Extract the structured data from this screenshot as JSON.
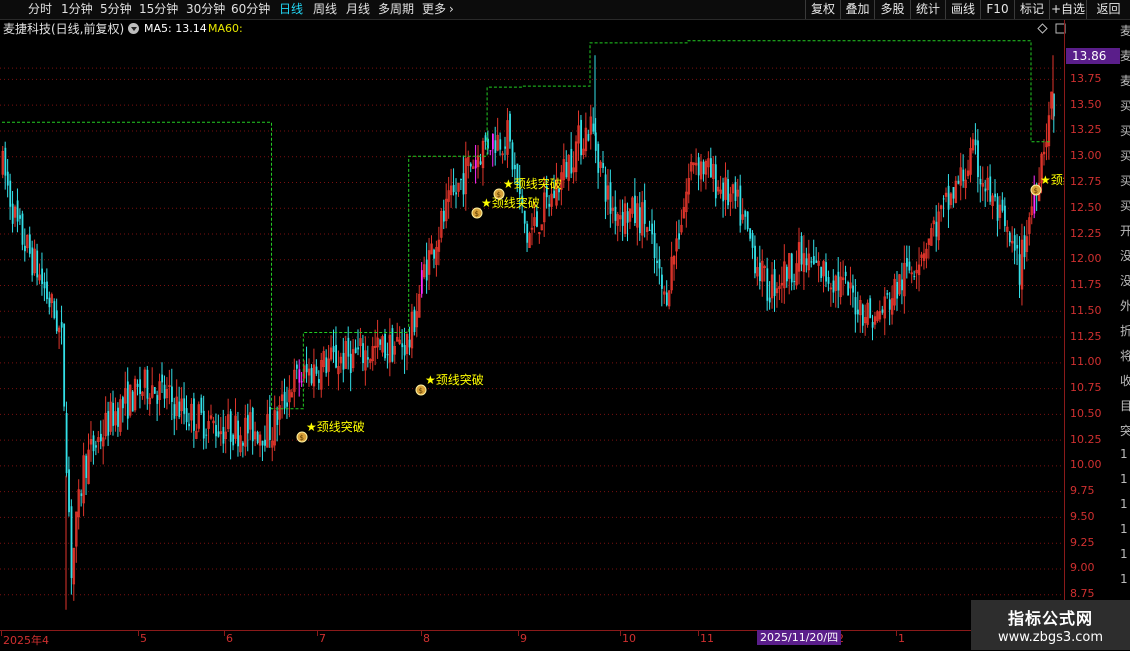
{
  "toolbar": {
    "periods": [
      {
        "label": "分时",
        "active": false
      },
      {
        "label": "1分钟",
        "active": false
      },
      {
        "label": "5分钟",
        "active": false
      },
      {
        "label": "15分钟",
        "active": false
      },
      {
        "label": "30分钟",
        "active": false
      },
      {
        "label": "60分钟",
        "active": false
      },
      {
        "label": "日线",
        "active": true
      },
      {
        "label": "周线",
        "active": false
      },
      {
        "label": "月线",
        "active": false
      },
      {
        "label": "多周期",
        "active": false
      }
    ],
    "more_label": "更多",
    "right_buttons": [
      "复权",
      "叠加",
      "多股",
      "统计",
      "画线",
      "F10",
      "标记",
      "+自选",
      "返回"
    ]
  },
  "info": {
    "title": "麦捷科技(日线,前复权)",
    "ma5": "MA5: 13.14",
    "ma60": "MA60:"
  },
  "colors": {
    "up": "#e0352b",
    "down": "#33e0e8",
    "signal": "#ff2cff",
    "ma60": "#22cc22",
    "annotation": "#ffff00",
    "grid": "#7a1010"
  },
  "price_axis": {
    "labels": [
      "13.75",
      "13.50",
      "13.25",
      "13.00",
      "12.75",
      "12.50",
      "12.25",
      "12.00",
      "11.75",
      "11.50",
      "11.25",
      "11.00",
      "10.75",
      "10.50",
      "10.25",
      "10.00",
      "9.75",
      "9.50",
      "9.25",
      "9.00",
      "8.75"
    ],
    "current": "13.86"
  },
  "time_axis": {
    "labels": [
      "2025年4",
      "5",
      "6",
      "7",
      "8",
      "9",
      "10",
      "11",
      "12",
      "1"
    ],
    "cursor_date": "2025/11/20/四"
  },
  "annotations": [
    "颈线突破",
    "颈线突破",
    "颈线突破",
    "颈线突破",
    "颈线突破",
    "颈线"
  ],
  "side_text": [
    "麦",
    "麦",
    "麦",
    "买",
    "买",
    "买",
    "买",
    "买",
    "开",
    "没",
    "没",
    "外",
    "折",
    "将",
    "收",
    "目",
    "突",
    "1",
    "1",
    "1",
    "1",
    "1",
    "1"
  ],
  "watermark": {
    "line1": "指标公式网",
    "line2": "www.zbgs3.com"
  },
  "chart_data": {
    "type": "candlestick",
    "y_range": [
      8.5,
      14.05
    ],
    "ma60_levels": [
      {
        "from": 0,
        "to": 110,
        "value": 13.33
      },
      {
        "from": 110,
        "to": 123,
        "value": 10.55
      },
      {
        "from": 123,
        "to": 166,
        "value": 11.29
      },
      {
        "from": 166,
        "to": 198,
        "value": 13.0
      },
      {
        "from": 198,
        "to": 212,
        "value": 13.67
      },
      {
        "from": 212,
        "to": 240,
        "value": 13.68
      },
      {
        "from": 240,
        "to": 280,
        "value": 14.1
      },
      {
        "from": 280,
        "to": 420,
        "value": 14.12
      },
      {
        "from": 420,
        "to": 432,
        "value": 13.14
      }
    ]
  }
}
